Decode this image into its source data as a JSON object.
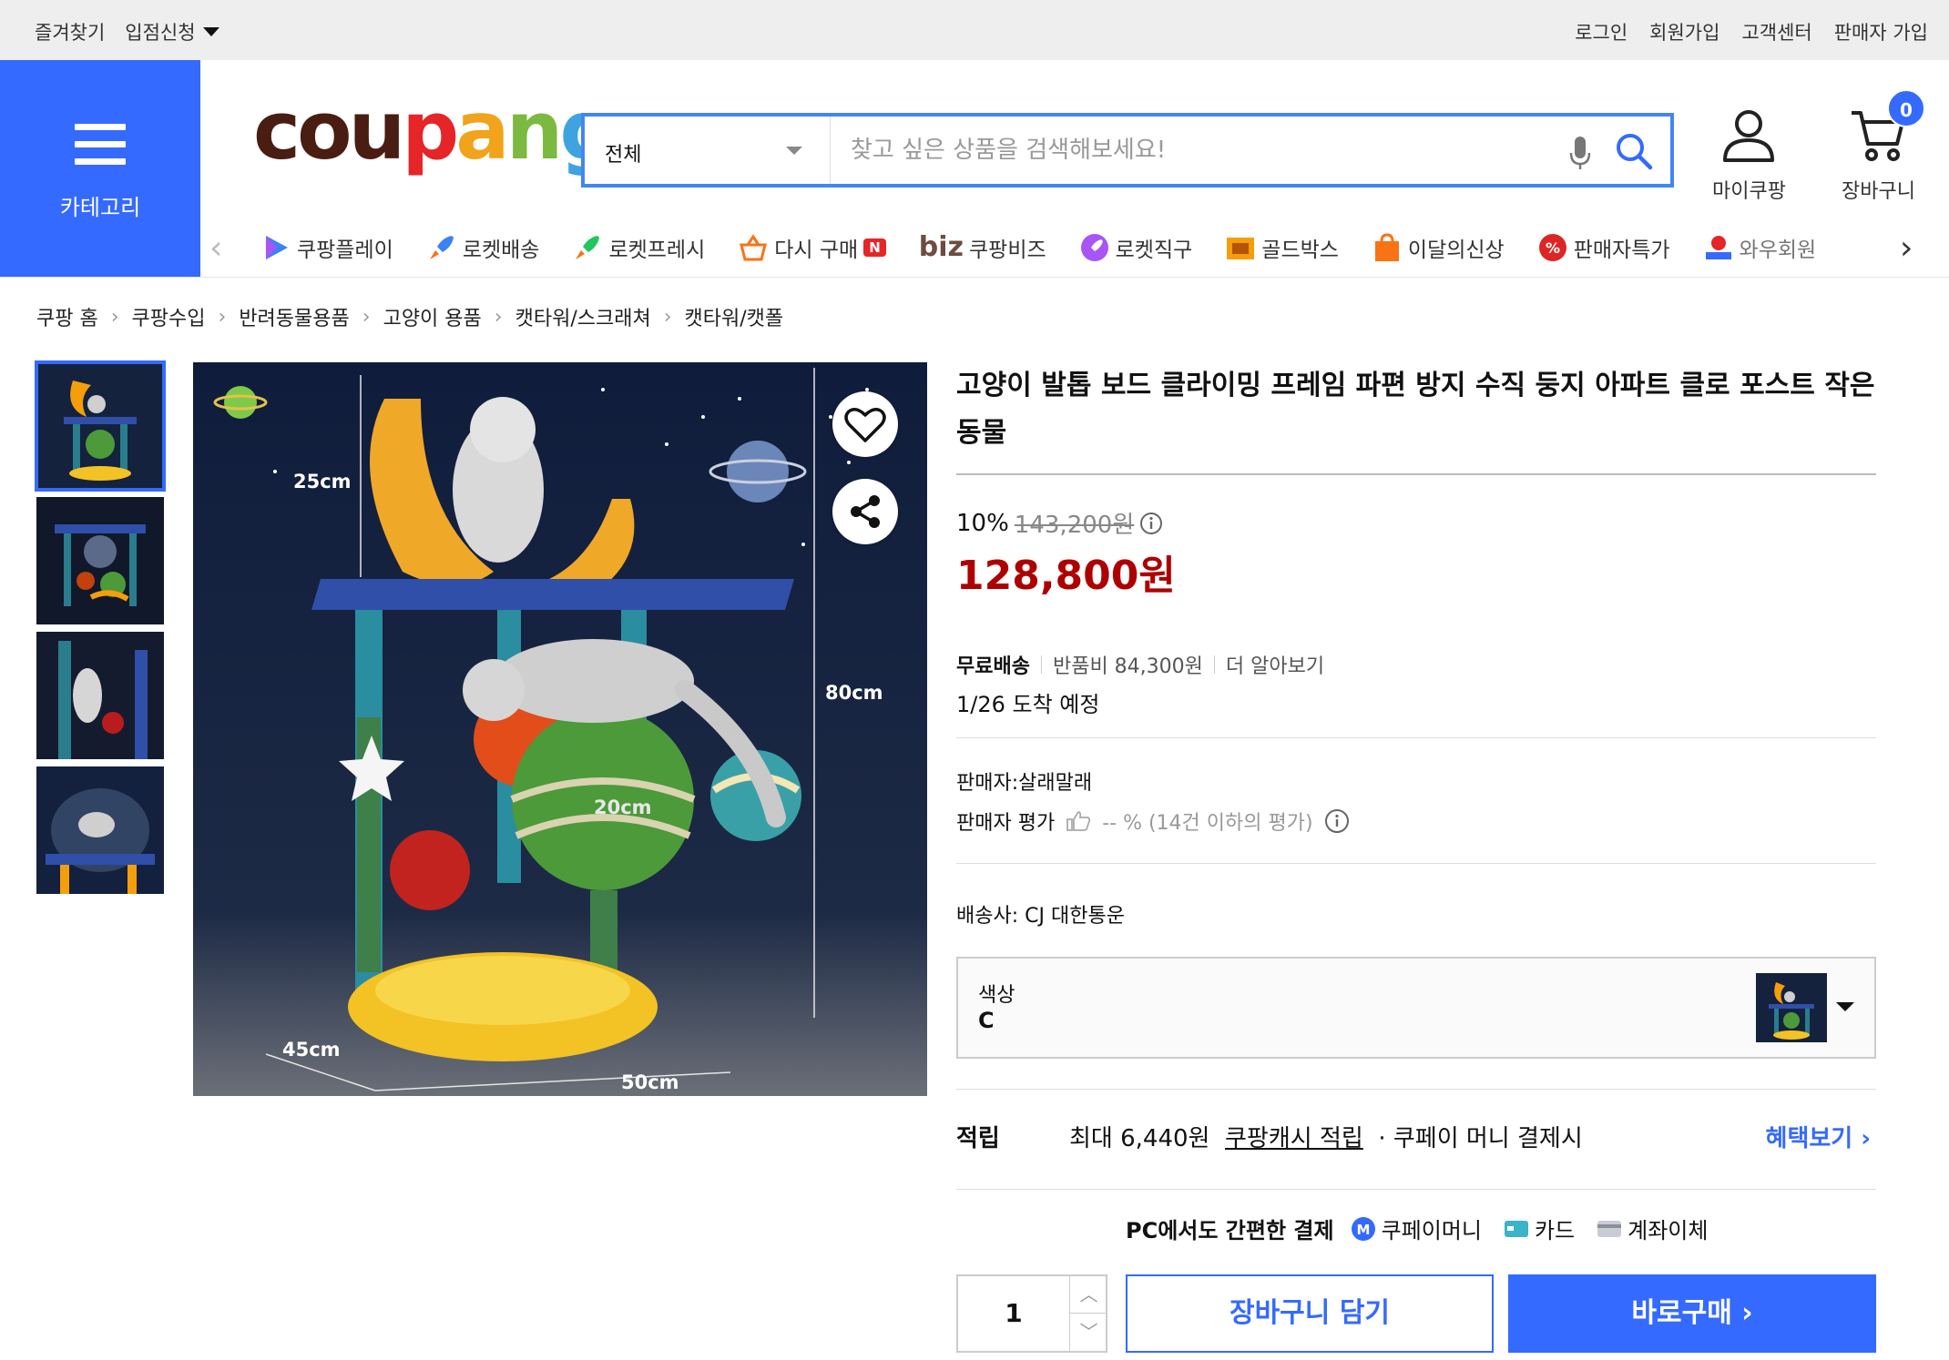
{
  "topbar": {
    "favorites": "즐겨찾기",
    "seller_apply": "입점신청",
    "login": "로그인",
    "signup": "회원가입",
    "customer_center": "고객센터",
    "seller_join": "판매자 가입"
  },
  "category": {
    "label": "카테고리"
  },
  "logo": {
    "text": "coupang"
  },
  "search": {
    "category_selected": "전체",
    "placeholder": "찾고 싶은 상품을 검색해보세요!"
  },
  "header_icons": {
    "mypage": "마이쿠팡",
    "cart": "장바구니",
    "cart_count": "0"
  },
  "nav": {
    "items": [
      "쿠팡플레이",
      "로켓배송",
      "로켓프레시",
      "다시 구매",
      "쿠팡비즈",
      "로켓직구",
      "골드박스",
      "이달의신상",
      "판매자특가",
      "와우회원"
    ],
    "biz_prefix": "biz",
    "new_badge": "N"
  },
  "breadcrumb": [
    "쿠팡 홈",
    "쿠팡수입",
    "반려동물용품",
    "고양이 용품",
    "캣타워/스크래쳐",
    "캣타워/캣폴"
  ],
  "product_image": {
    "dim_top": "25cm",
    "dim_height": "80cm",
    "dim_ball": "20cm",
    "dim_depth": "45cm",
    "dim_width": "50cm"
  },
  "product": {
    "title": "고양이 발톱 보드 클라이밍 프레임 파편 방지 수직 둥지 아파트 클로 포스트 작은 동물",
    "discount_rate": "10%",
    "original_price": "143,200원",
    "price": "128,800원",
    "free_shipping": "무료배송",
    "return_fee": "반품비 84,300원",
    "learn_more": "더 알아보기",
    "arrival": "1/26 도착 예정",
    "seller": "판매자:살래말래",
    "seller_rating_label": "판매자 평가",
    "seller_rating_value": "-- % (14건 이하의 평가)",
    "delivery_company": "배송사:  CJ 대한통운",
    "option_label": "색상",
    "option_value": "C",
    "reward_label": "적립",
    "reward_amount": "최대 6,440원",
    "reward_link": "쿠팡캐시 적립",
    "reward_condition": "· 쿠페이 머니 결제시",
    "benefits_link": "혜택보기 ›",
    "pay_heading": "PC에서도 간편한 결제",
    "pay_methods": [
      "쿠페이머니",
      "카드",
      "계좌이체"
    ],
    "quantity": "1",
    "add_to_cart": "장바구니 담기",
    "buy_now": "바로구매  ›"
  },
  "colors": {
    "brand_blue": "#346aff",
    "search_border": "#4285f4",
    "price_red": "#ae0000"
  }
}
